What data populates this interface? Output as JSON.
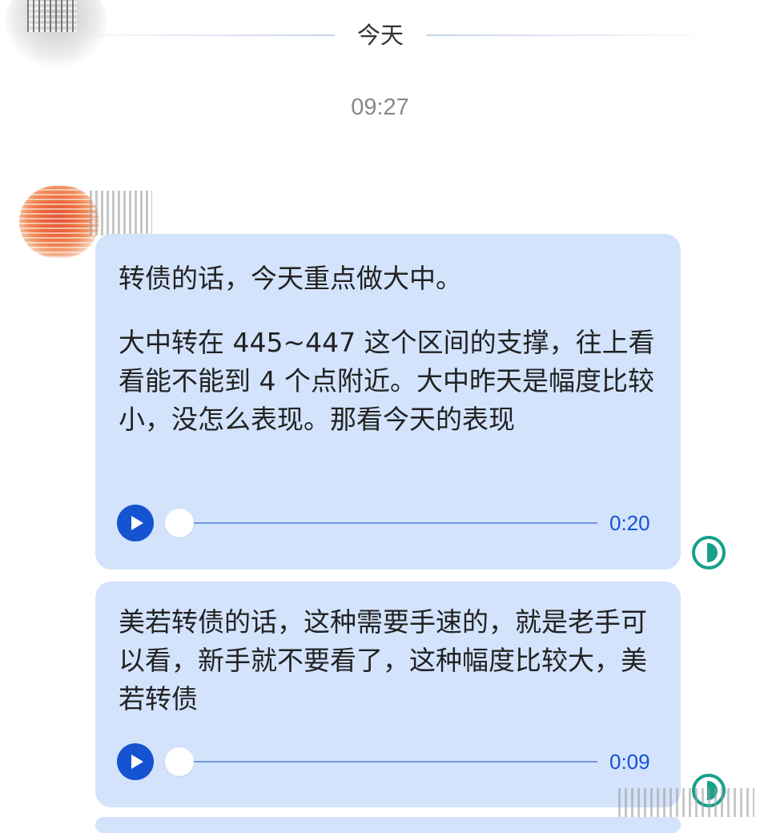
{
  "date_divider": {
    "label": "今天"
  },
  "timestamp": "09:27",
  "messages": [
    {
      "paragraphs": [
        "转债的话，今天重点做大中。",
        "大中转在 445~447 这个区间的支撑，往上看看能不能到 4 个点附近。大中昨天是幅度比较小，没怎么表现。那看今天的表现"
      ],
      "audio_duration": "0:20",
      "read_status_icon": "read-receipt-icon"
    },
    {
      "paragraphs": [
        "美若转债的话，这种需要手速的，就是老手可以看，新手就不要看了，这种幅度比较大，美若转债"
      ],
      "audio_duration": "0:09",
      "read_status_icon": "read-receipt-icon"
    }
  ],
  "colors": {
    "bubble_bg": "#d3e3fc",
    "accent_blue": "#1553d1",
    "read_green": "#16a18a",
    "timestamp_gray": "#888888"
  }
}
